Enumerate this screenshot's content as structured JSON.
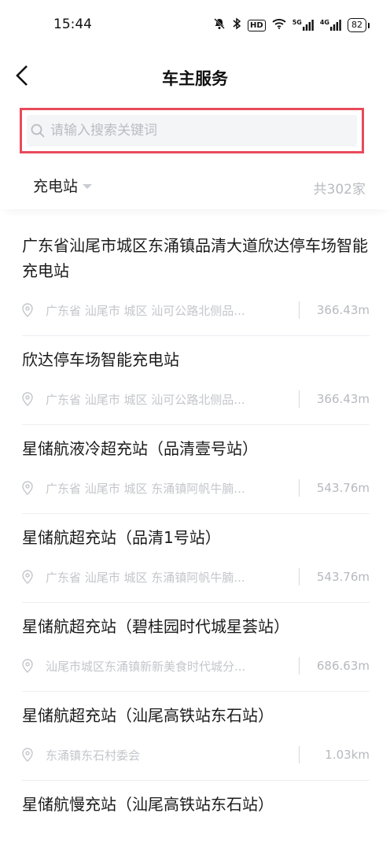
{
  "status_bar": {
    "time": "15:44",
    "icons": [
      "bell-off-icon",
      "bluetooth-icon",
      "hd-icon",
      "wifi-icon",
      "signal-5g-icon",
      "signal-4g-icon"
    ],
    "hd_label": "HD",
    "net1": "5G",
    "net2": "4G",
    "battery": "82"
  },
  "nav": {
    "title": "车主服务"
  },
  "search": {
    "placeholder": "请输入搜索关键词",
    "value": "",
    "highlight_color": "#e84a5b"
  },
  "filter": {
    "label": "充电站",
    "count": "共302家"
  },
  "stations": [
    {
      "name": "广东省汕尾市城区东涌镇品清大道欣达停车场智能充电站",
      "address": "广东省 汕尾市 城区 汕可公路北侧品...",
      "distance": "366.43m"
    },
    {
      "name": "欣达停车场智能充电站",
      "address": "广东省 汕尾市 城区 汕可公路北侧品...",
      "distance": "366.43m"
    },
    {
      "name": "星储航液冷超充站（品清壹号站）",
      "address": "广东省 汕尾市 城区 东涌镇阿帆牛腩...",
      "distance": "543.76m"
    },
    {
      "name": "星储航超充站（品清1号站）",
      "address": "广东省 汕尾市 城区 东涌镇阿帆牛腩...",
      "distance": "543.76m"
    },
    {
      "name": "星储航超充站（碧桂园时代城星荟站）",
      "address": "汕尾市城区东涌镇新新美食时代城分...",
      "distance": "686.63m"
    },
    {
      "name": "星储航超充站（汕尾高铁站东石站）",
      "address": "东涌镇东石村委会",
      "distance": "1.03km"
    },
    {
      "name": "星储航慢充站（汕尾高铁站东石站）",
      "address": "",
      "distance": ""
    }
  ]
}
